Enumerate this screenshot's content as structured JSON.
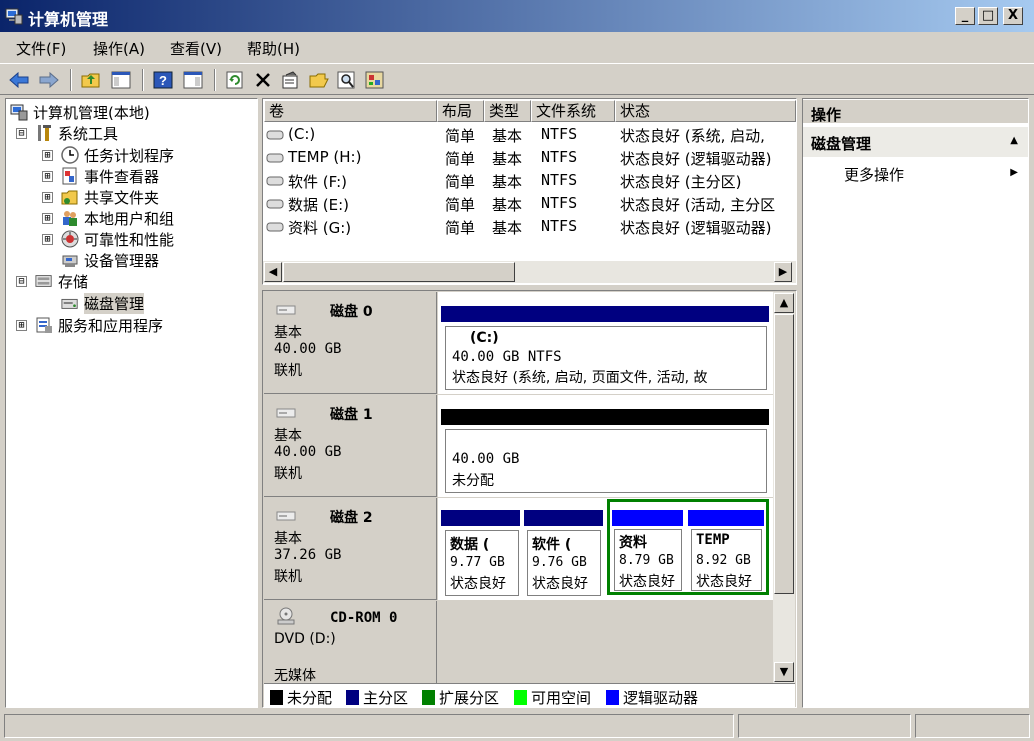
{
  "window": {
    "title": "计算机管理",
    "min": "_",
    "max": "□",
    "close": "X"
  },
  "menu": [
    "文件(F)",
    "操作(A)",
    "查看(V)",
    "帮助(H)"
  ],
  "tree": {
    "root": "计算机管理(本地)",
    "system_tools": "系统工具",
    "task_scheduler": "任务计划程序",
    "event_viewer": "事件查看器",
    "shared_folders": "共享文件夹",
    "local_users": "本地用户和组",
    "reliability": "可靠性和性能",
    "device_manager": "设备管理器",
    "storage": "存储",
    "disk_mgmt": "磁盘管理",
    "services_apps": "服务和应用程序",
    "expand": "⊞",
    "collapse": "⊟"
  },
  "volume_columns": [
    "卷",
    "布局",
    "类型",
    "文件系统",
    "状态"
  ],
  "volumes": [
    {
      "name": "(C:)",
      "layout": "简单",
      "type": "基本",
      "fs": "NTFS",
      "status": "状态良好 (系统, 启动,"
    },
    {
      "name": "TEMP (H:)",
      "layout": "简单",
      "type": "基本",
      "fs": "NTFS",
      "status": "状态良好 (逻辑驱动器)"
    },
    {
      "name": "软件 (F:)",
      "layout": "简单",
      "type": "基本",
      "fs": "NTFS",
      "status": "状态良好 (主分区)"
    },
    {
      "name": "数据 (E:)",
      "layout": "简单",
      "type": "基本",
      "fs": "NTFS",
      "status": "状态良好 (活动, 主分区"
    },
    {
      "name": "资料 (G:)",
      "layout": "简单",
      "type": "基本",
      "fs": "NTFS",
      "status": "状态良好 (逻辑驱动器)"
    }
  ],
  "disks": [
    {
      "name": "磁盘 0",
      "type": "基本",
      "size": "40.00 GB",
      "state": "联机",
      "part": {
        "title": "(C:)",
        "line1": "40.00 GB NTFS",
        "line2": "状态良好 (系统, 启动, 页面文件, 活动, 故"
      }
    },
    {
      "name": "磁盘 1",
      "type": "基本",
      "size": "40.00 GB",
      "state": "联机",
      "part": {
        "line1": "40.00 GB",
        "line2": "未分配"
      }
    },
    {
      "name": "磁盘 2",
      "type": "基本",
      "size": "37.26 GB",
      "state": "联机",
      "parts": [
        {
          "title": "数据 (",
          "size": "9.77 GB",
          "status": "状态良好"
        },
        {
          "title": "软件 (",
          "size": "9.76 GB",
          "status": "状态良好"
        },
        {
          "title": "资料",
          "size": "8.79 GB",
          "status": "状态良好"
        },
        {
          "title": "TEMP",
          "size": "8.92 GB",
          "status": "状态良好"
        }
      ]
    },
    {
      "name": "CD-ROM 0",
      "type": "DVD (D:)",
      "state": "无媒体"
    }
  ],
  "legend": [
    "未分配",
    "主分区",
    "扩展分区",
    "可用空间",
    "逻辑驱动器"
  ],
  "colors": {
    "unallocated": "#000000",
    "primary": "#000080",
    "extended": "#008000",
    "free": "#00ff00",
    "logical": "#0000ff"
  },
  "actions": {
    "header": "操作",
    "section": "磁盘管理",
    "more": "更多操作",
    "collapse_arrow": "▲",
    "submenu_arrow": "▶"
  },
  "scroll": {
    "left": "◀",
    "right": "▶",
    "up": "▲",
    "down": "▼"
  }
}
